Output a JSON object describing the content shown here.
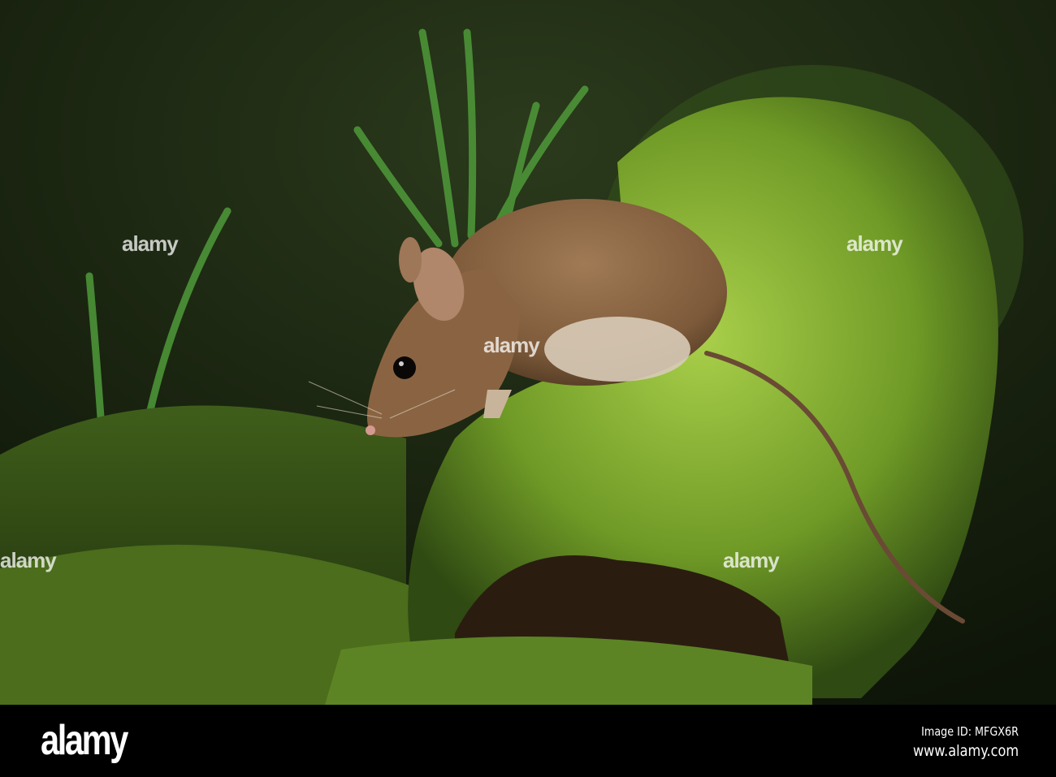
{
  "photo": {
    "subject": "wood-mouse-on-moss",
    "colors": {
      "background": "#1e2a14",
      "moss": "#7fae2e",
      "mouse": "#8a6442",
      "belly": "#d8cbb8"
    }
  },
  "watermark": {
    "text": "alamy"
  },
  "footer": {
    "logo": "alamy",
    "image_id": "Image ID: MFGX6R",
    "url": "www.alamy.com"
  }
}
